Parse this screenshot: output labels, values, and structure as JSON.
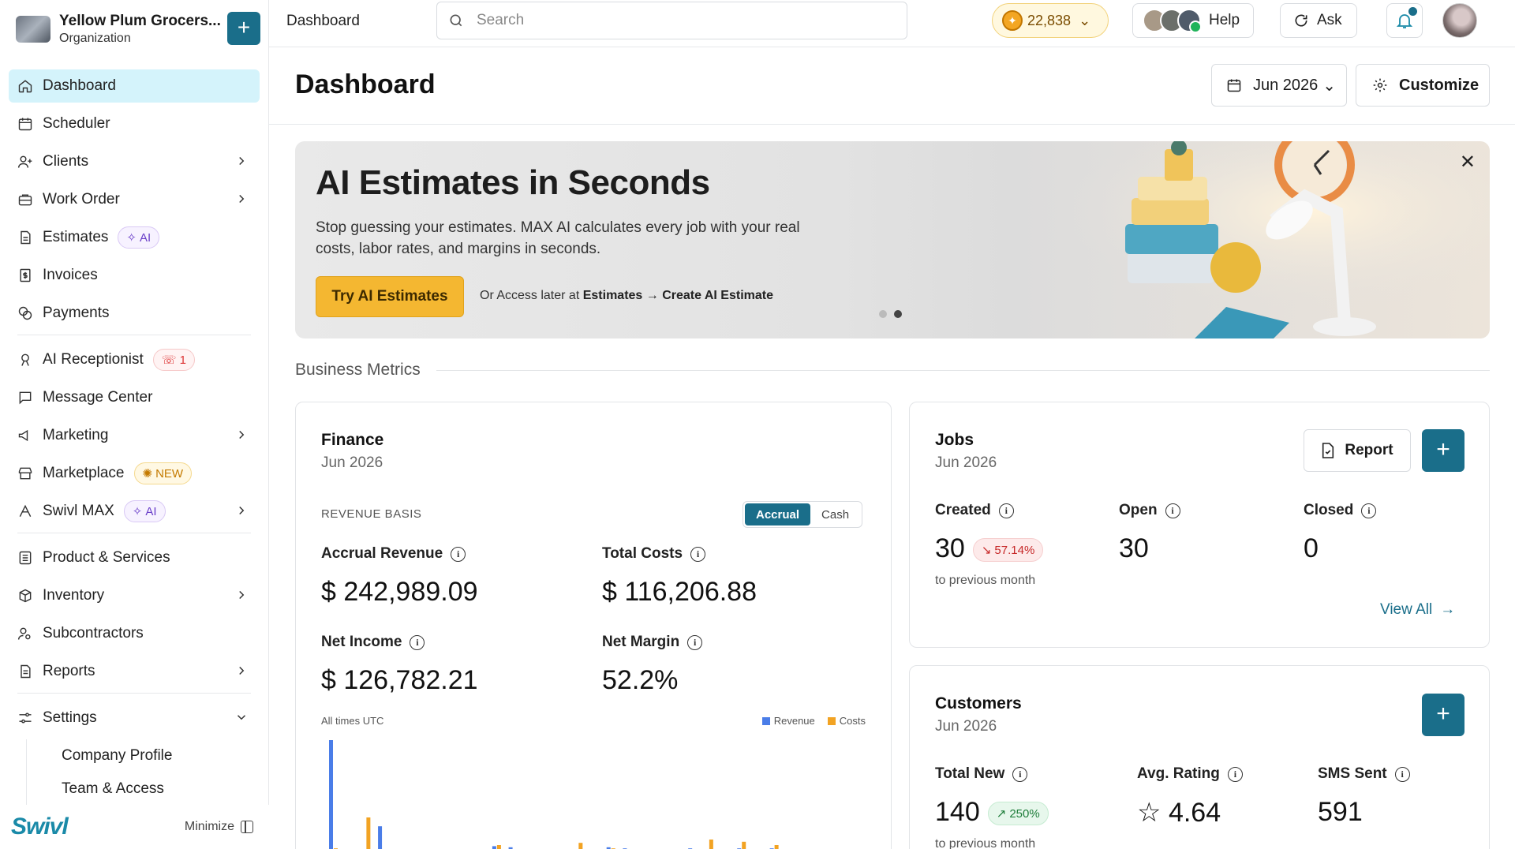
{
  "org": {
    "name": "Yellow Plum Grocers...",
    "type": "Organization"
  },
  "nav": {
    "dashboard": "Dashboard",
    "scheduler": "Scheduler",
    "clients": "Clients",
    "work_order": "Work Order",
    "estimates": "Estimates",
    "estimates_badge": "AI",
    "invoices": "Invoices",
    "payments": "Payments",
    "ai_receptionist": "AI Receptionist",
    "ai_receptionist_badge": "1",
    "message_center": "Message Center",
    "marketing": "Marketing",
    "marketplace": "Marketplace",
    "marketplace_badge": "NEW",
    "swivl_max": "Swivl MAX",
    "swivl_max_badge": "AI",
    "products": "Product & Services",
    "inventory": "Inventory",
    "subcontractors": "Subcontractors",
    "reports": "Reports",
    "settings": "Settings",
    "settings_sub": [
      "Company Profile",
      "Team & Access"
    ]
  },
  "footer": {
    "brand": "Swivl",
    "minimize": "Minimize"
  },
  "topbar": {
    "crumb": "Dashboard",
    "search_placeholder": "Search",
    "coins": "22,838",
    "help": "Help",
    "ask": "Ask"
  },
  "page": {
    "title": "Dashboard",
    "date": "Jun 2026",
    "customize": "Customize"
  },
  "banner": {
    "title": "AI Estimates in Seconds",
    "text": "Stop guessing your estimates. MAX AI calculates every job with your real costs, labor rates, and margins in seconds.",
    "cta": "Try AI Estimates",
    "later_prefix": "Or Access later at",
    "later_path": "Estimates → Create AI Estimate"
  },
  "section": "Business Metrics",
  "finance": {
    "title": "Finance",
    "period": "Jun 2026",
    "basis_label": "REVENUE BASIS",
    "toggle": [
      "Accrual",
      "Cash"
    ],
    "accrual_revenue_label": "Accrual Revenue",
    "accrual_revenue": "$ 242,989.09",
    "total_costs_label": "Total Costs",
    "total_costs": "$ 116,206.88",
    "net_income_label": "Net Income",
    "net_income": "$ 126,782.21",
    "net_margin_label": "Net Margin",
    "net_margin": "52.2%",
    "timezone": "All times UTC",
    "legend": [
      "Revenue",
      "Costs"
    ]
  },
  "jobs": {
    "title": "Jobs",
    "period": "Jun 2026",
    "report": "Report",
    "created_label": "Created",
    "created": "30",
    "created_change": "57.14%",
    "open_label": "Open",
    "open": "30",
    "closed_label": "Closed",
    "closed": "0",
    "compare": "to previous month",
    "view_all": "View All"
  },
  "customers": {
    "title": "Customers",
    "period": "Jun 2026",
    "total_new_label": "Total New",
    "total_new": "140",
    "total_new_change": "250%",
    "rating_label": "Avg. Rating",
    "rating": "4.64",
    "sms_label": "SMS Sent",
    "sms": "591",
    "compare": "to previous month"
  },
  "colors": {
    "accent": "#1a6e8a",
    "revenue": "#4a7de8",
    "costs": "#f2a323",
    "cta": "#f4b731"
  },
  "chart_data": {
    "type": "bar",
    "series": [
      {
        "name": "Revenue",
        "values": [
          100,
          0,
          0,
          22,
          0,
          0,
          0,
          0,
          0,
          0,
          4,
          3,
          0,
          0,
          0,
          0,
          0,
          3,
          2,
          0,
          0,
          0,
          2,
          0,
          0,
          2,
          0,
          2,
          0
        ]
      },
      {
        "name": "Costs",
        "values": [
          2,
          0,
          30,
          0,
          0,
          0,
          1,
          0,
          0,
          0,
          5,
          0,
          0,
          0,
          0,
          7,
          0,
          2,
          0,
          0,
          0,
          0,
          0,
          10,
          0,
          8,
          0,
          5,
          0
        ]
      }
    ]
  }
}
